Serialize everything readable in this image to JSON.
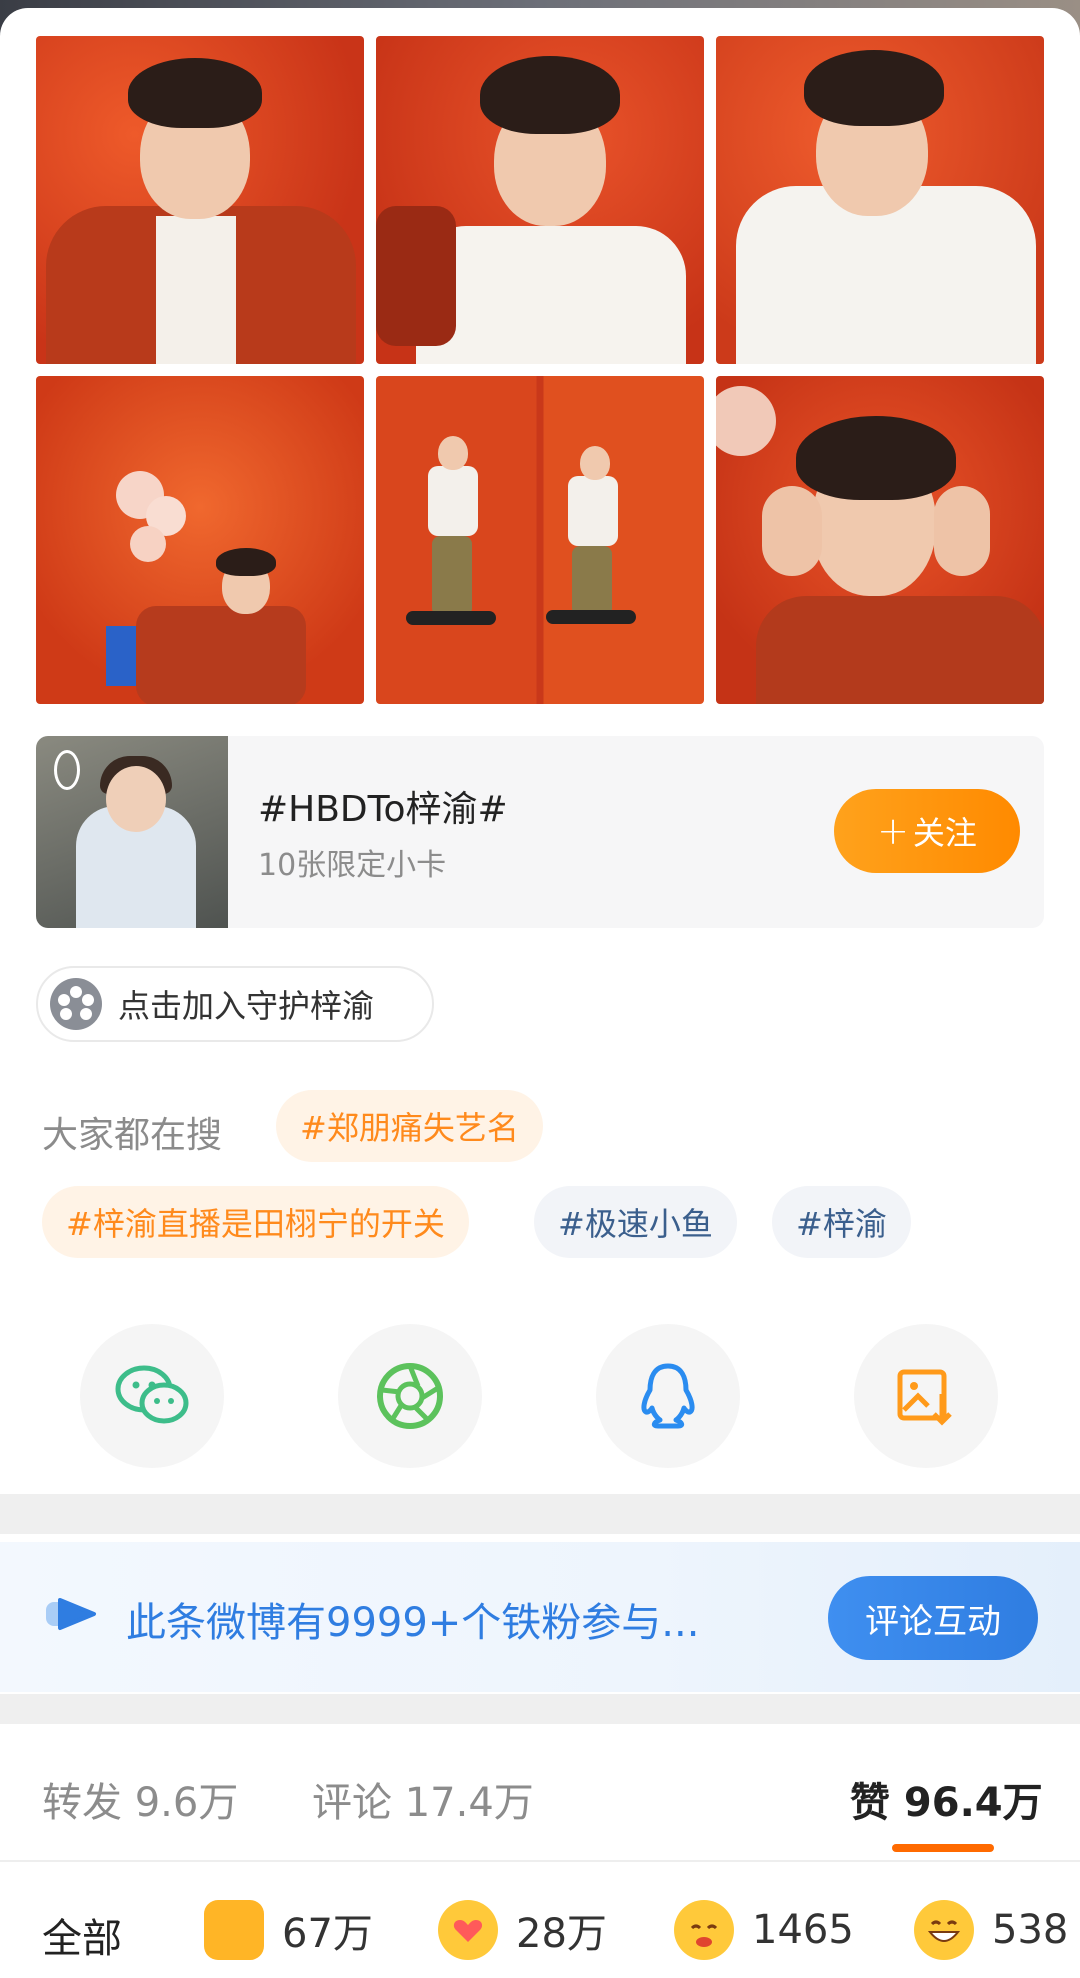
{
  "topic": {
    "title": "#HBDTo梓渝#",
    "subtitle": "10张限定小卡",
    "follow_label": "关注",
    "follow_plus": "+"
  },
  "guard": {
    "label": "点击加入守护梓渝"
  },
  "hot_search": {
    "label": "大家都在搜",
    "tags": [
      {
        "text": "#郑朋痛失艺名",
        "style": "hot"
      },
      {
        "text": "#梓渝直播是田栩宁的开关",
        "style": "hot"
      },
      {
        "text": "#极速小鱼",
        "style": "blue"
      },
      {
        "text": "#梓渝",
        "style": "blue"
      }
    ]
  },
  "share": {
    "icons": [
      "wechat-icon",
      "moments-icon",
      "qq-icon",
      "save-image-icon"
    ]
  },
  "fan_banner": {
    "text": "此条微博有9999+个铁粉参与...",
    "button": "评论互动"
  },
  "stats": {
    "repost": "转发 9.6万",
    "comment": "评论 17.4万",
    "like": "赞 96.4万"
  },
  "reactions": {
    "all_label": "全部",
    "items": [
      {
        "icon": "thumbs-up-icon",
        "count": "67万"
      },
      {
        "icon": "heart-face-icon",
        "count": "28万"
      },
      {
        "icon": "hug-face-icon",
        "count": "1465"
      },
      {
        "icon": "grin-face-icon",
        "count": "538"
      }
    ]
  },
  "colors": {
    "accent_orange": "#ff8a00",
    "accent_blue": "#2f7de1",
    "photo_red": "#d9421e"
  }
}
